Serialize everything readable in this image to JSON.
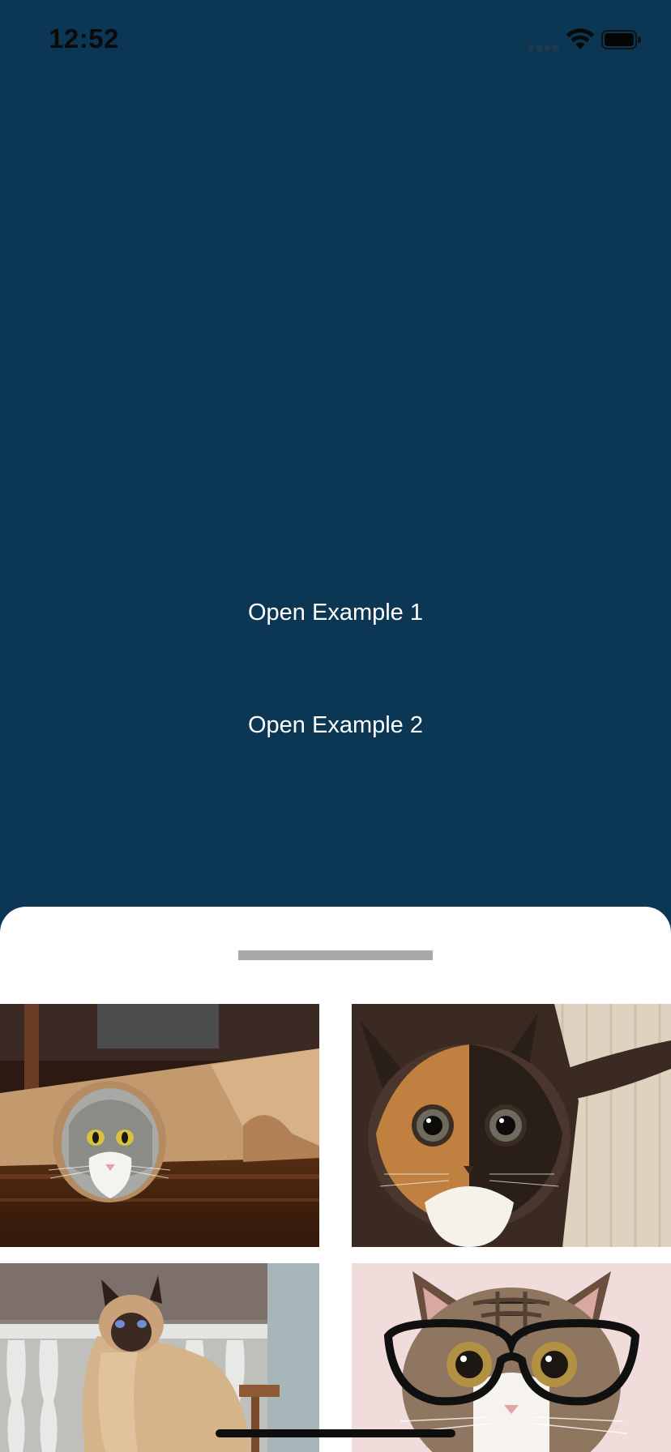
{
  "status_bar": {
    "time": "12:52",
    "icons": [
      "signal-icon",
      "wifi-icon",
      "battery-icon"
    ]
  },
  "main": {
    "background_color": "#0b3754",
    "buttons": [
      {
        "label": "Open Example 1"
      },
      {
        "label": "Open Example 2"
      }
    ]
  },
  "bottom_sheet": {
    "background_color": "#ffffff",
    "handle_color": "#a9a9a9",
    "gallery": [
      {
        "subject": "cat-peeking-out-of-paper-roll"
      },
      {
        "subject": "two-toned-calico-kitten"
      },
      {
        "subject": "siamese-cat-on-porch"
      },
      {
        "subject": "tabby-cat-wearing-glasses"
      }
    ]
  }
}
